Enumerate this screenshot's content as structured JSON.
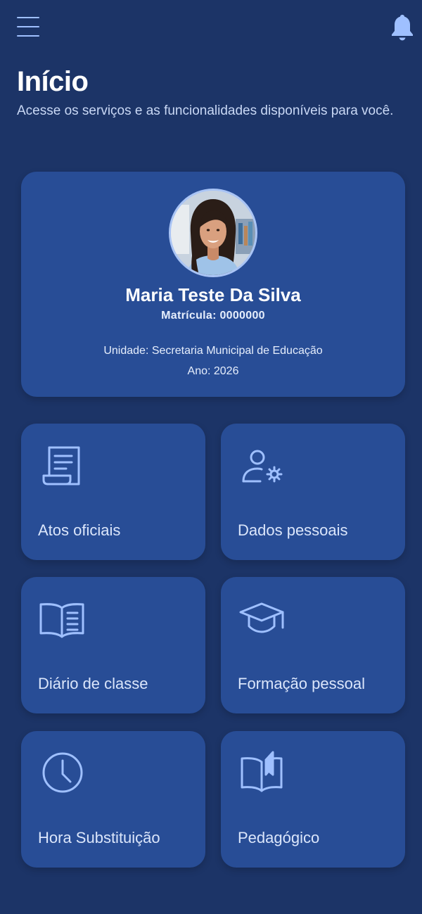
{
  "header": {
    "menu_icon": "hamburger-menu-icon",
    "notification_icon": "bell-icon",
    "title": "Início",
    "subtitle": "Acesse os serviços e as funcionalidades disponíveis para você."
  },
  "profile": {
    "name": "Maria Teste Da Silva",
    "registration": "Matrícula: 0000000",
    "unit": "Unidade: Secretaria Municipal de Educação",
    "year": "Ano: 2026"
  },
  "tiles": [
    {
      "label": "Atos oficiais",
      "icon": "document-scroll-icon"
    },
    {
      "label": "Dados pessoais",
      "icon": "user-settings-icon"
    },
    {
      "label": "Diário de classe",
      "icon": "open-book-icon"
    },
    {
      "label": "Formação pessoal",
      "icon": "graduation-cap-icon"
    },
    {
      "label": "Hora Substituição",
      "icon": "clock-icon"
    },
    {
      "label": "Pedagógico",
      "icon": "book-bookmark-icon"
    }
  ],
  "colors": {
    "background": "#1c3467",
    "card": "#284d96",
    "icon": "#9fc0ff"
  }
}
